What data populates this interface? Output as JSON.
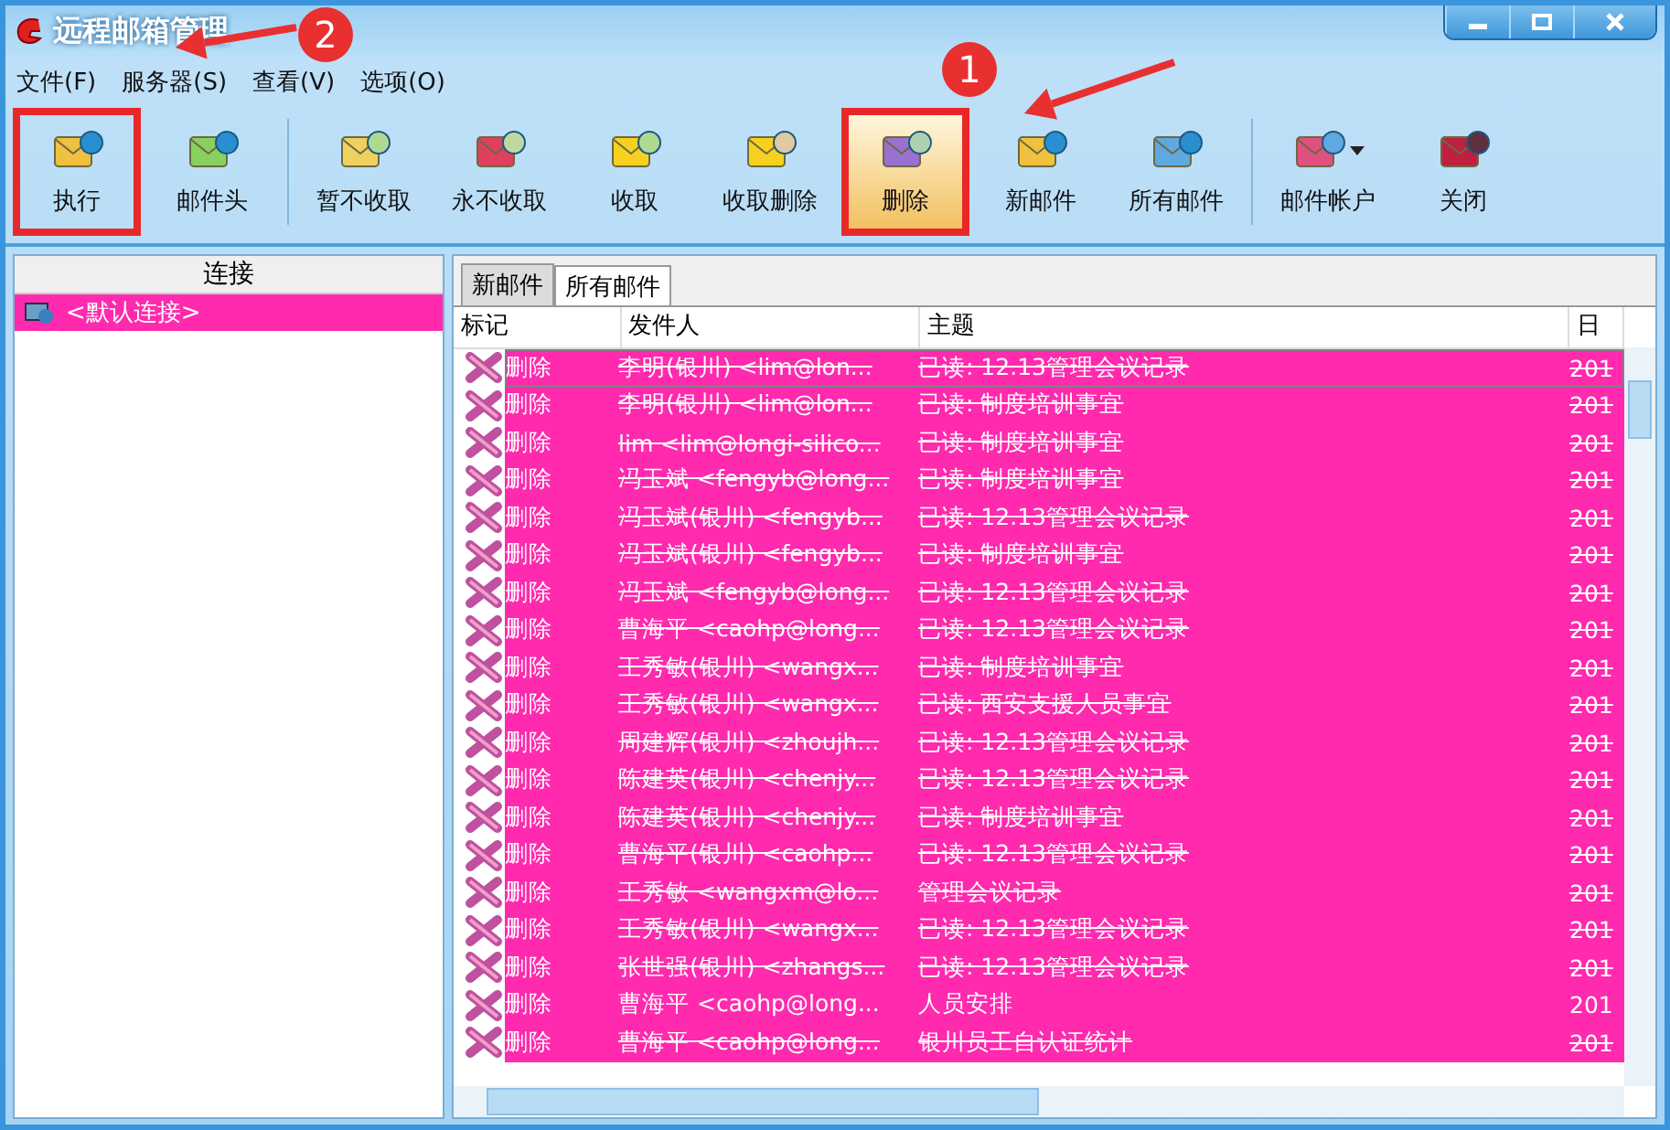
{
  "window": {
    "title": "远程邮箱管理"
  },
  "menu": [
    "文件(F)",
    "服务器(S)",
    "查看(V)",
    "选项(O)"
  ],
  "toolbar": {
    "groups": [
      [
        {
          "label": "执行",
          "pressed": false,
          "outlined": true,
          "has_menu": false
        },
        {
          "label": "邮件头",
          "pressed": false,
          "outlined": false,
          "has_menu": false
        }
      ],
      [
        {
          "label": "暂不收取",
          "pressed": false,
          "outlined": false,
          "has_menu": false
        },
        {
          "label": "永不收取",
          "pressed": false,
          "outlined": false,
          "has_menu": false
        },
        {
          "label": "收取",
          "pressed": false,
          "outlined": false,
          "has_menu": false
        },
        {
          "label": "收取删除",
          "pressed": false,
          "outlined": false,
          "has_menu": false
        },
        {
          "label": "删除",
          "pressed": true,
          "outlined": true,
          "has_menu": false
        },
        {
          "label": "新邮件",
          "pressed": false,
          "outlined": false,
          "has_menu": false
        },
        {
          "label": "所有邮件",
          "pressed": false,
          "outlined": false,
          "has_menu": false
        }
      ],
      [
        {
          "label": "邮件帐户",
          "pressed": false,
          "outlined": false,
          "has_menu": true
        },
        {
          "label": "关闭",
          "pressed": false,
          "outlined": false,
          "has_menu": false
        }
      ]
    ]
  },
  "annotations": [
    {
      "label": "1"
    },
    {
      "label": "2"
    }
  ],
  "sidebar": {
    "header": "连接",
    "items": [
      {
        "label": "<默认连接>",
        "selected": true
      }
    ]
  },
  "tabs": [
    {
      "label": "新邮件",
      "selected": false
    },
    {
      "label": "所有邮件",
      "selected": true
    }
  ],
  "table": {
    "columns": [
      "标记",
      "发件人",
      "主题",
      "日"
    ],
    "rows": [
      {
        "mark": "删除",
        "sender": "李明(银川) <lim@lon...",
        "subject": "已读: 12.13管理会议记录",
        "date": "201",
        "selected": true,
        "deleted": true
      },
      {
        "mark": "删除",
        "sender": "李明(银川) <lim@lon...",
        "subject": "已读: 制度培训事宜",
        "date": "201",
        "selected": true,
        "deleted": true
      },
      {
        "mark": "删除",
        "sender": "lim <lim@longi-silico...",
        "subject": "已读: 制度培训事宜",
        "date": "201",
        "selected": true,
        "deleted": true
      },
      {
        "mark": "删除",
        "sender": "冯玉斌 <fengyb@long...",
        "subject": "已读: 制度培训事宜",
        "date": "201",
        "selected": true,
        "deleted": true
      },
      {
        "mark": "删除",
        "sender": "冯玉斌(银川) <fengyb...",
        "subject": "已读: 12.13管理会议记录",
        "date": "201",
        "selected": true,
        "deleted": true
      },
      {
        "mark": "删除",
        "sender": "冯玉斌(银川) <fengyb...",
        "subject": "已读: 制度培训事宜",
        "date": "201",
        "selected": true,
        "deleted": true
      },
      {
        "mark": "删除",
        "sender": "冯玉斌 <fengyb@long...",
        "subject": "已读: 12.13管理会议记录",
        "date": "201",
        "selected": true,
        "deleted": true
      },
      {
        "mark": "删除",
        "sender": "曹海平 <caohp@long...",
        "subject": "已读: 12.13管理会议记录",
        "date": "201",
        "selected": true,
        "deleted": true
      },
      {
        "mark": "删除",
        "sender": "王秀敏(银川) <wangx...",
        "subject": "已读: 制度培训事宜",
        "date": "201",
        "selected": true,
        "deleted": true
      },
      {
        "mark": "删除",
        "sender": "王秀敏(银川) <wangx...",
        "subject": "已读: 西安支援人员事宜",
        "date": "201",
        "selected": true,
        "deleted": true
      },
      {
        "mark": "删除",
        "sender": "周建辉(银川) <zhoujh...",
        "subject": "已读: 12.13管理会议记录",
        "date": "201",
        "selected": true,
        "deleted": true
      },
      {
        "mark": "删除",
        "sender": "陈建英(银川) <chenjy...",
        "subject": "已读: 12.13管理会议记录",
        "date": "201",
        "selected": true,
        "deleted": true
      },
      {
        "mark": "删除",
        "sender": "陈建英(银川) <chenjy...",
        "subject": "已读: 制度培训事宜",
        "date": "201",
        "selected": true,
        "deleted": true
      },
      {
        "mark": "删除",
        "sender": "曹海平(银川) <caohp...",
        "subject": "已读: 12.13管理会议记录",
        "date": "201",
        "selected": true,
        "deleted": true
      },
      {
        "mark": "删除",
        "sender": "王秀敏 <wangxm@lo...",
        "subject": "管理会议记录",
        "date": "201",
        "selected": true,
        "deleted": true
      },
      {
        "mark": "删除",
        "sender": "王秀敏(银川) <wangx...",
        "subject": "已读: 12.13管理会议记录",
        "date": "201",
        "selected": true,
        "deleted": true
      },
      {
        "mark": "删除",
        "sender": "张世强(银川) <zhangs...",
        "subject": "已读: 12.13管理会议记录",
        "date": "201",
        "selected": true,
        "deleted": true
      },
      {
        "mark": "删除",
        "sender": "曹海平 <caohp@long...",
        "subject": "人员安排",
        "date": "201",
        "selected": true,
        "deleted": false
      },
      {
        "mark": "删除",
        "sender": "曹海平 <caohp@long...",
        "subject": "银川员工自认证统计",
        "date": "201",
        "selected": true,
        "deleted": true
      }
    ]
  }
}
